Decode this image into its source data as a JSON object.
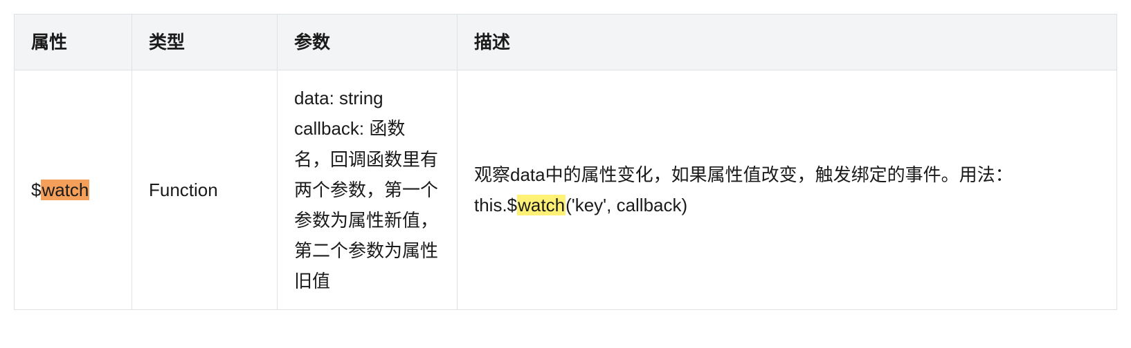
{
  "table": {
    "headers": {
      "attribute": "属性",
      "type": "类型",
      "args": "参数",
      "description": "描述"
    },
    "rows": [
      {
        "attribute": {
          "prefix": "$",
          "highlighted": "watch"
        },
        "type": "Function",
        "args": "data: string callback: 函数名，回调函数里有两个参数，第一个参数为属性新值，第二个参数为属性旧值",
        "description": {
          "line1": "观察data中的属性变化，如果属性值改变，触发绑定的事件。用法：",
          "usage_prefix": "this.$",
          "usage_highlighted": "watch",
          "usage_suffix": "('key', callback)"
        }
      }
    ]
  }
}
